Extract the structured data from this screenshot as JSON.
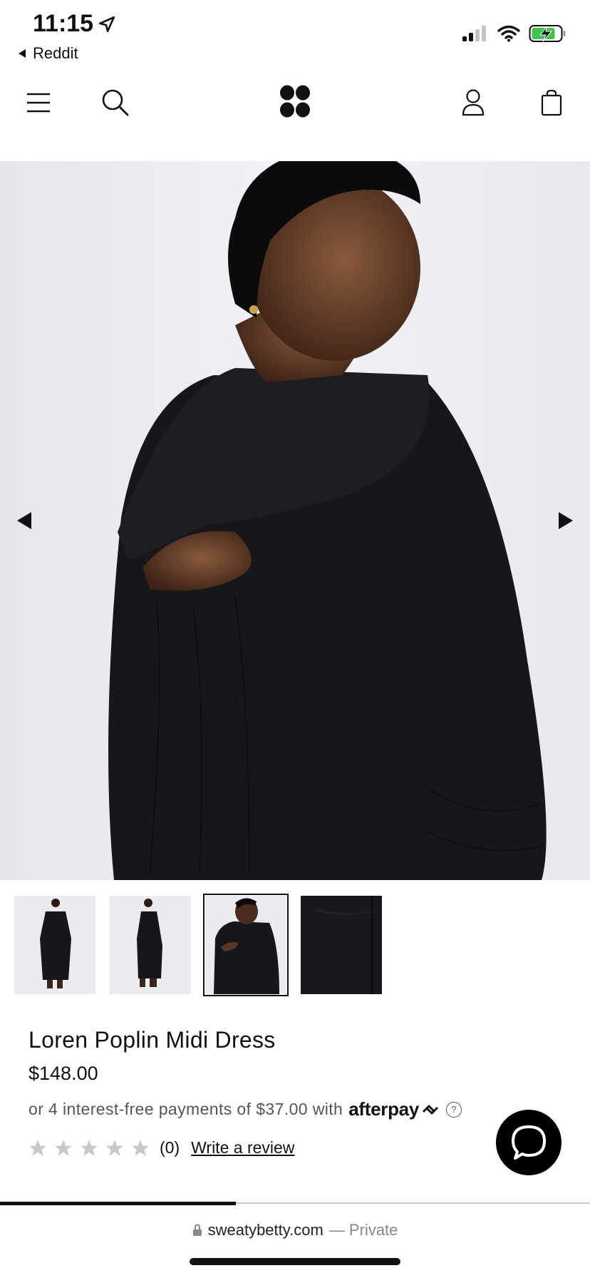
{
  "status_bar": {
    "time": "11:15",
    "back_app": "Reddit"
  },
  "header": {
    "menu_icon": "hamburger-menu-icon",
    "search_icon": "search-icon",
    "logo": "sweaty-betty-logo",
    "account_icon": "account-icon",
    "bag_icon": "shopping-bag-icon"
  },
  "gallery": {
    "main_image": "model-wearing-black-dress-back-view",
    "prev_icon": "arrow-left-icon",
    "next_icon": "arrow-right-icon",
    "thumbnails": [
      {
        "name": "front-full-length"
      },
      {
        "name": "side-full-length"
      },
      {
        "name": "back-cutout-closeup"
      },
      {
        "name": "fabric-detail"
      }
    ],
    "active_thumbnail": 3
  },
  "product": {
    "title": "Loren Poplin Midi Dress",
    "price": "$148.00",
    "installment_text": "or 4 interest-free payments of $37.00 with",
    "afterpay_label": "afterpay",
    "rating_count": "(0)",
    "review_link": "Write a review",
    "stars": 5
  },
  "footer": {
    "url": "sweatybetty.com",
    "private": "— Private",
    "scroll_progress": 0.4
  },
  "colors": {
    "text": "#111111",
    "muted": "#555555",
    "star": "#c8c8c8",
    "chat": "#000000"
  }
}
